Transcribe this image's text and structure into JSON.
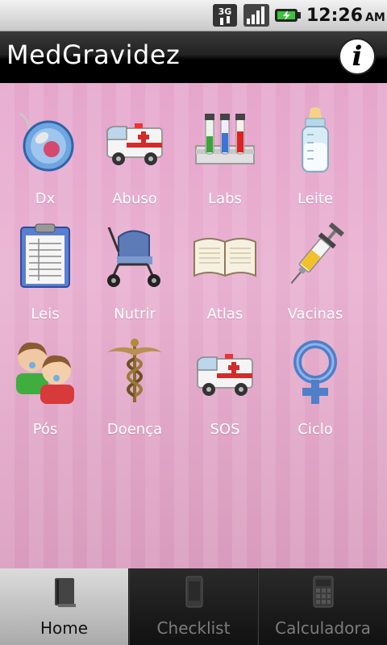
{
  "status_bar": {
    "network_type": "3G",
    "time": "12:26",
    "ampm": "AM"
  },
  "app_bar": {
    "title": "MedGravidez",
    "info_icon": "info-icon"
  },
  "grid": {
    "items": [
      {
        "label": "Dx",
        "icon": "sperm-egg-icon"
      },
      {
        "label": "Abuso",
        "icon": "ambulance-icon"
      },
      {
        "label": "Labs",
        "icon": "test-tubes-icon"
      },
      {
        "label": "Leite",
        "icon": "baby-bottle-icon"
      },
      {
        "label": "Leis",
        "icon": "clipboard-icon"
      },
      {
        "label": "Nutrir",
        "icon": "stroller-icon"
      },
      {
        "label": "Atlas",
        "icon": "open-book-icon"
      },
      {
        "label": "Vacinas",
        "icon": "syringe-icon"
      },
      {
        "label": "Pós",
        "icon": "babies-icon"
      },
      {
        "label": "Doença",
        "icon": "caduceus-icon"
      },
      {
        "label": "SOS",
        "icon": "ambulance-icon"
      },
      {
        "label": "Ciclo",
        "icon": "female-symbol-icon"
      }
    ]
  },
  "tabs": [
    {
      "label": "Home",
      "icon": "book-icon",
      "active": true
    },
    {
      "label": "Checklist",
      "icon": "phone-icon",
      "active": false
    },
    {
      "label": "Calculadora",
      "icon": "calculator-icon",
      "active": false
    }
  ],
  "colors": {
    "background_pink": "#e8b0d0",
    "app_bar": "#000000",
    "label_text": "#ffffff"
  }
}
